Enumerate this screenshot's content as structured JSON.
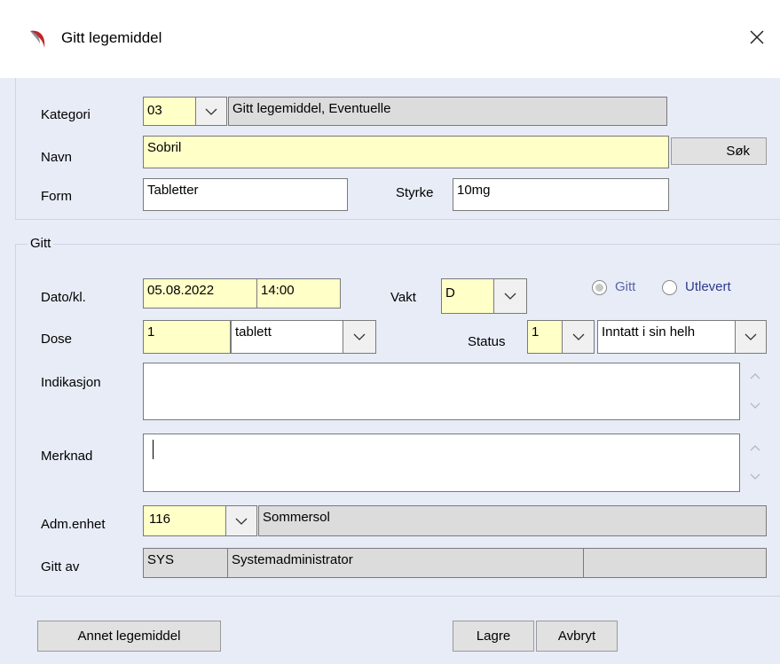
{
  "window": {
    "title": "Gitt legemiddel"
  },
  "top": {
    "kategori": {
      "label": "Kategori",
      "code": "03",
      "desc": "Gitt legemiddel, Eventuelle"
    },
    "navn": {
      "label": "Navn",
      "value": "Sobril",
      "search_button": "Søk"
    },
    "form": {
      "label": "Form",
      "value": "Tabletter"
    },
    "styrke": {
      "label": "Styrke",
      "value": "10mg"
    }
  },
  "gitt": {
    "legend": "Gitt",
    "dato": {
      "label": "Dato/kl.",
      "date": "05.08.2022",
      "time": "14:00"
    },
    "vakt": {
      "label": "Vakt",
      "value": "D"
    },
    "radios": {
      "gitt": "Gitt",
      "utlevert": "Utlevert",
      "selected": "Gitt"
    },
    "dose": {
      "label": "Dose",
      "value": "1",
      "unit": "tablett"
    },
    "status": {
      "label": "Status",
      "code": "1",
      "desc": "Inntatt i sin helh"
    },
    "indikasjon": {
      "label": "Indikasjon",
      "value": ""
    },
    "merknad": {
      "label": "Merknad",
      "value": ""
    },
    "adm": {
      "label": "Adm.enhet",
      "code": "116",
      "name": "Sommersol"
    },
    "gitt_av": {
      "label": "Gitt av",
      "code": "SYS",
      "name": "Systemadministrator",
      "extra": ""
    }
  },
  "buttons": {
    "annet": "Annet legemiddel",
    "lagre": "Lagre",
    "avbryt": "Avbryt"
  },
  "colors": {
    "field_yellow": "#ffffc8",
    "readonly_grey": "#dcdcdc",
    "dialog_bg": "#e7ecf7",
    "radio_text": "#2f3a8c"
  },
  "icons": {
    "logo": "app-logo-icon",
    "close": "close-icon",
    "dropdown": "chevron-down-icon",
    "scroll_up": "scroll-up-icon",
    "scroll_down": "scroll-down-icon"
  }
}
